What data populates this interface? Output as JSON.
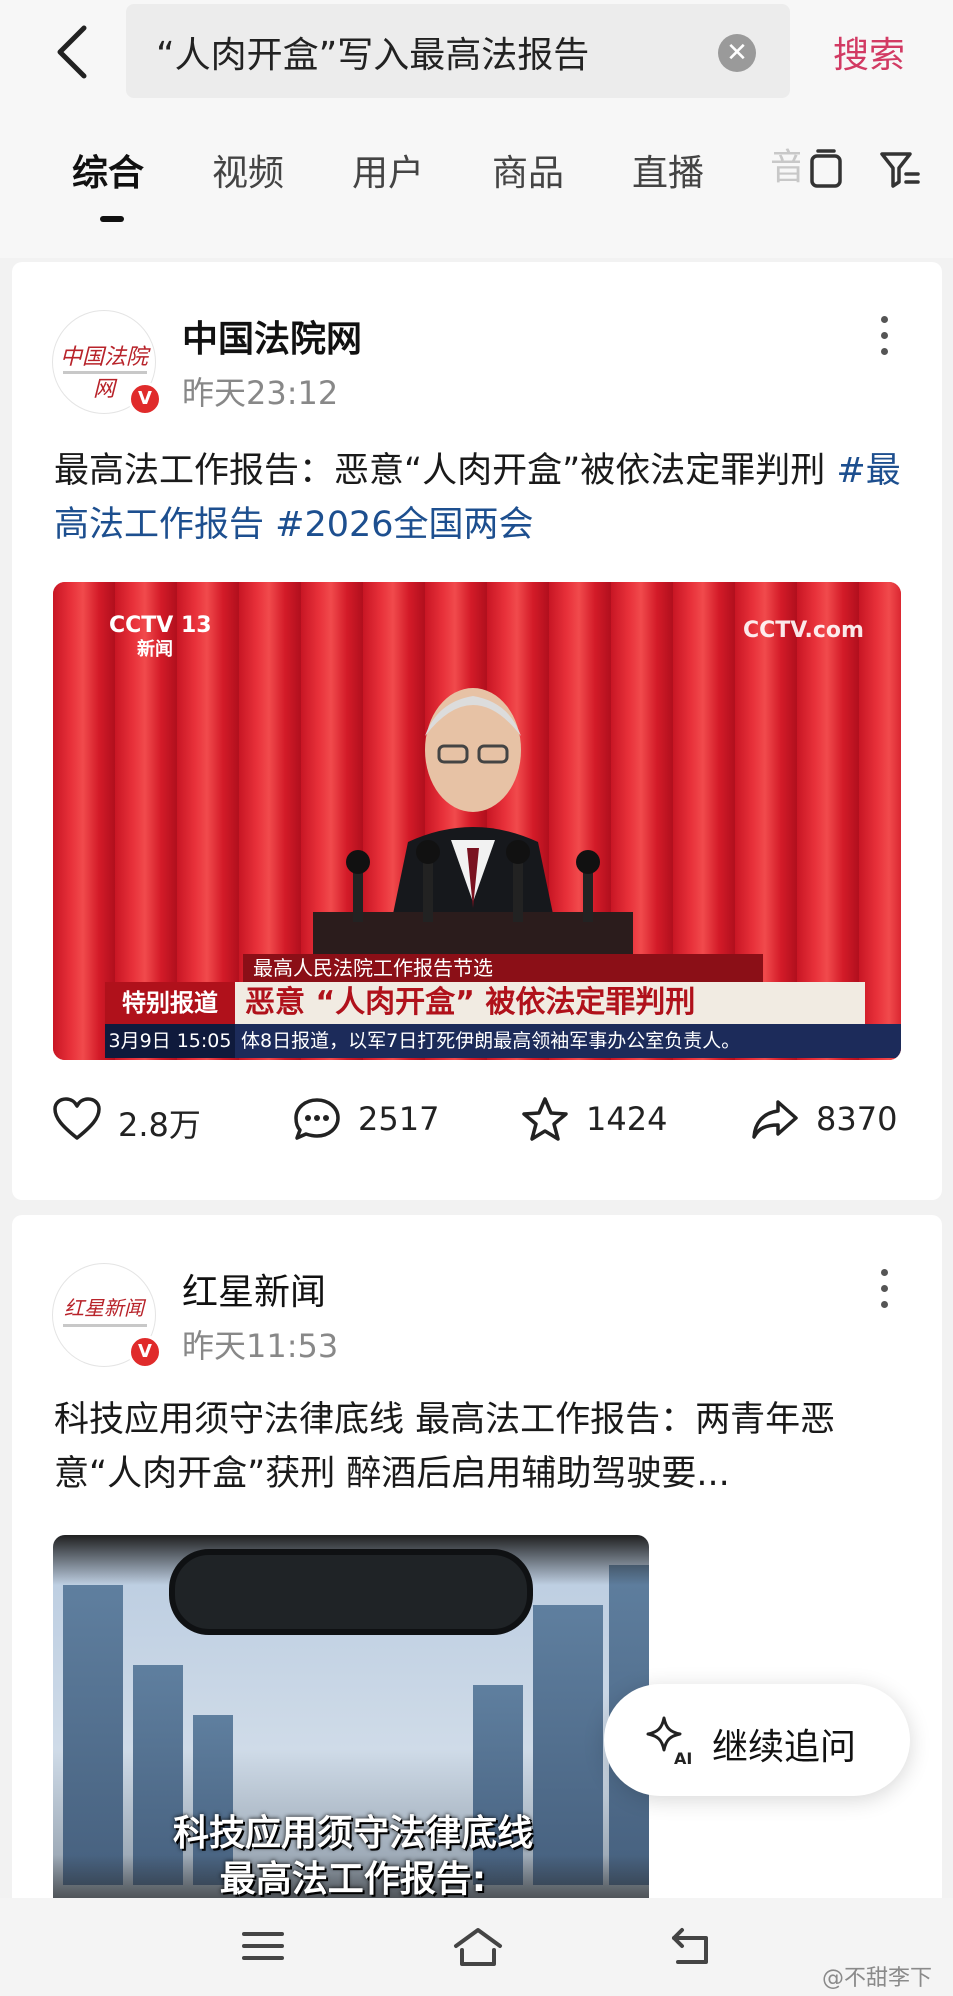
{
  "search": {
    "query": "“人肉开盒”写入最高法报告",
    "clear_symbol": "✕",
    "submit_label": "搜索"
  },
  "tabs": [
    {
      "label": "综合",
      "active": true
    },
    {
      "label": "视频"
    },
    {
      "label": "用户"
    },
    {
      "label": "商品"
    },
    {
      "label": "直播"
    }
  ],
  "posts": [
    {
      "author": "中国法院网",
      "avatar_logo": "中国法院网",
      "verified_badge": "V",
      "time": "昨天23:12",
      "text": "最高法工作报告：恶意“人肉开盒”被依法定罪判刑 ",
      "hashtags": [
        "#最高法工作报告",
        "#2026全国两会"
      ],
      "video": {
        "channel_logo": "CCTV 13",
        "channel_sub": "新闻",
        "site_logo": "CCTV.com",
        "segment_title": "最高人民法院工作报告节选",
        "tag": "特别报道",
        "headline": "恶意 “人肉开盒” 被依法定罪判刑",
        "date": "3月9日 15:05",
        "ticker": "体8日报道，以军7日打死伊朗最高领袖军事办公室负责人。"
      },
      "stats": {
        "likes": "2.8万",
        "comments": "2517",
        "favorites": "1424",
        "shares": "8370"
      }
    },
    {
      "author": "红星新闻",
      "avatar_logo": "红星新闻",
      "verified_badge": "V",
      "time": "昨天11:53",
      "text": "科技应用须守法律底线 最高法工作报告：两青年恶意“人肉开盒”获刑 醉酒后启用辅助驾驶要...",
      "image_caption_line1": "科技应用须守法律底线",
      "image_caption_line2": "最高法工作报告:"
    }
  ],
  "fab": {
    "label": "继续追问",
    "icon_text": "AI"
  },
  "watermark": "@不甜李下",
  "colors": {
    "accent": "#d23a63",
    "hashtag": "#1d4f8f",
    "badge": "#e02b2b"
  }
}
